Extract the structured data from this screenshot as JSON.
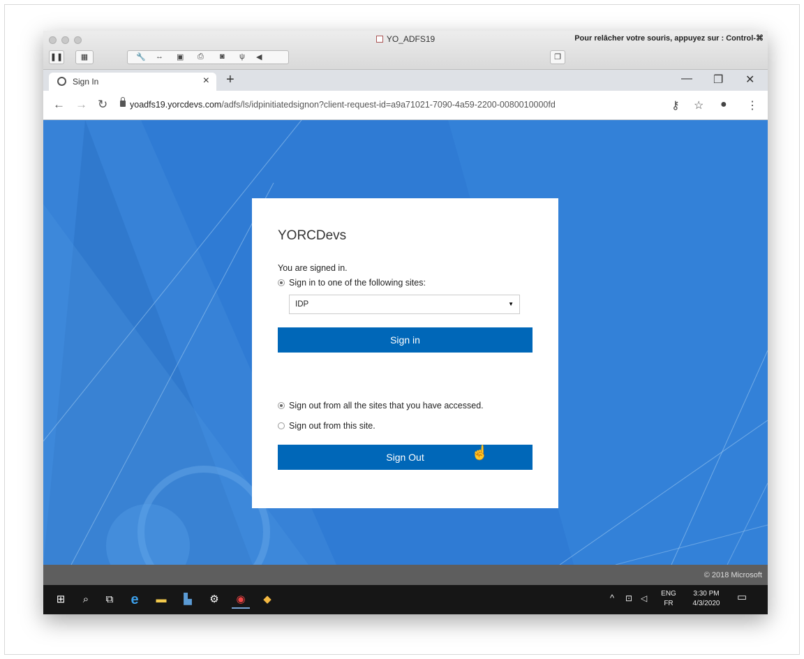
{
  "vm": {
    "title": "YO_ADFS19",
    "hint": "Pour relâcher votre souris, appuyez sur : Control-⌘"
  },
  "browser": {
    "tab_title": "Sign In",
    "tab_close": "×",
    "new_tab": "+",
    "url_host": "yoadfs19.yorcdevs.com",
    "url_path": "/adfs/ls/idpinitiatedsignon?client-request-id=a9a71021-7090-4a59-2200-0080010000fd",
    "icons": [
      "back-icon",
      "forward-icon",
      "reload-icon",
      "lock-icon",
      "key-icon",
      "star-icon",
      "account-icon",
      "menu-icon"
    ]
  },
  "page": {
    "org_name": "YORCDevs",
    "signed_in_text": "You are signed in.",
    "radio_signin_label": "Sign in to one of the following sites:",
    "site_select_value": "IDP",
    "signin_button": "Sign in",
    "radio_signout_all_label": "Sign out from all the sites that you have accessed.",
    "radio_signout_this_label": "Sign out from this site.",
    "signout_button": "Sign Out",
    "copyright": "© 2018 Microsoft",
    "background_color": "#2f7bd4",
    "button_color": "#0067b8"
  },
  "taskbar": {
    "lang_top": "ENG",
    "lang_bottom": "FR",
    "time": "3:30 PM",
    "date": "4/3/2020"
  }
}
